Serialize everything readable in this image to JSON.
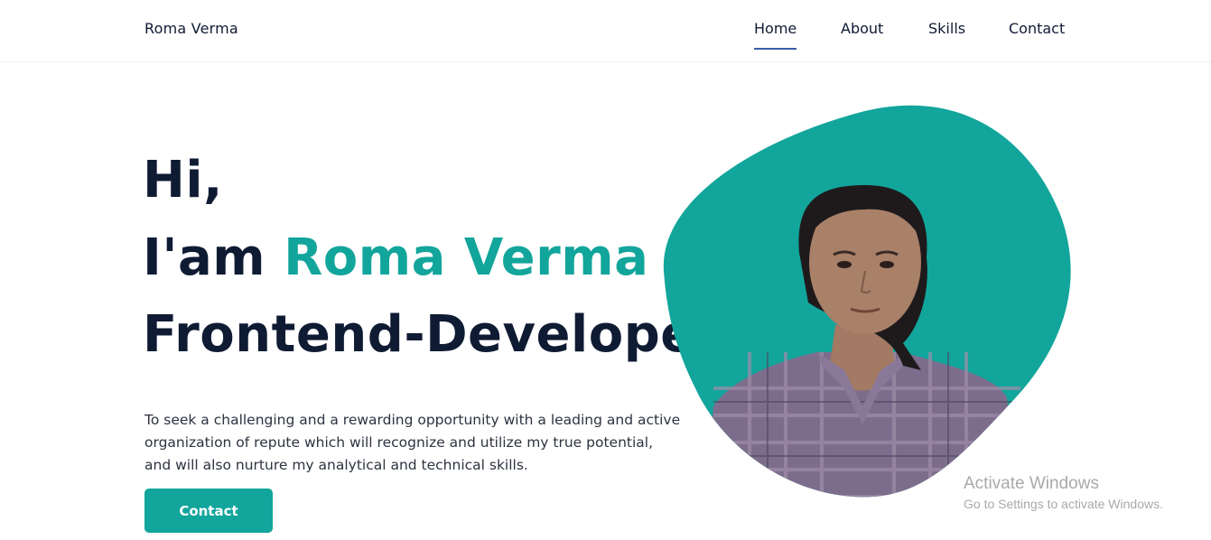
{
  "header": {
    "logo": "Roma Verma",
    "nav": [
      {
        "label": "Home",
        "active": true
      },
      {
        "label": "About",
        "active": false
      },
      {
        "label": "Skills",
        "active": false
      },
      {
        "label": "Contact",
        "active": false
      }
    ]
  },
  "hero": {
    "greeting": "Hi,",
    "intro_prefix": "I'am",
    "name": "Roma Verma",
    "role": "Frontend-Developer",
    "description_lines": [
      "To seek a challenging and a rewarding opportunity with a leading and active",
      "organization of repute which will recognize and utilize my true potential,",
      "and will also nurture my analytical and technical skills."
    ],
    "cta_label": "Contact"
  },
  "os_watermark": {
    "title": "Activate Windows",
    "subtitle": "Go to Settings to activate Windows."
  },
  "colors": {
    "accent": "#12a59b",
    "text_dark": "#0f1b33",
    "nav_underline": "#3a5ea8"
  }
}
